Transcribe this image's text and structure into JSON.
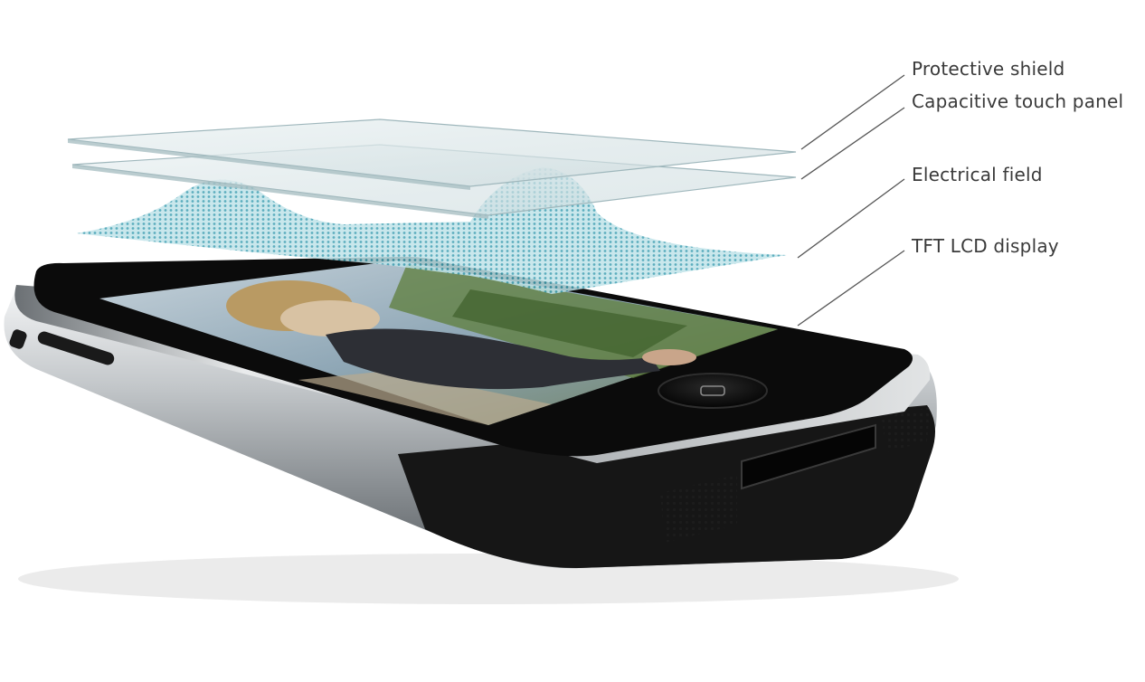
{
  "diagram": {
    "labels": [
      {
        "id": "protective",
        "text": "Protective shield"
      },
      {
        "id": "capacitive",
        "text": "Capacitive touch panel"
      },
      {
        "id": "electrical",
        "text": "Electrical field"
      },
      {
        "id": "tft",
        "text": "TFT LCD display"
      }
    ]
  },
  "colors": {
    "glass": "#dde8ea",
    "field": "#58b4c4",
    "phone_body": "#c9ccce",
    "phone_face": "#0b0b0b",
    "label_text": "#3a3a3a"
  }
}
